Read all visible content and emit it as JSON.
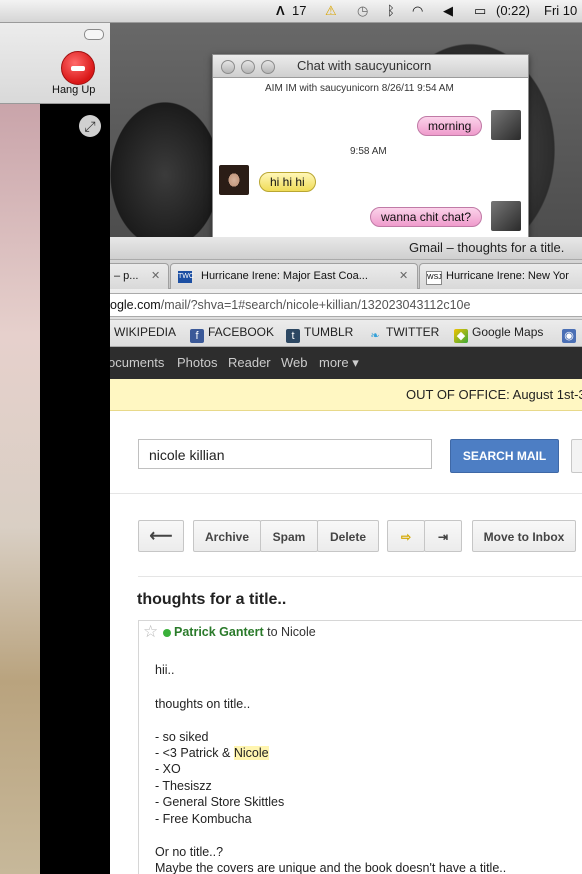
{
  "menubar": {
    "adobe_count": "17",
    "battery_time": "(0:22)",
    "clock": "Fri 10"
  },
  "video_chat": {
    "hang_up_label": "Hang Up"
  },
  "chat": {
    "window_title": "Chat with saucyunicorn",
    "session_info": "AIM IM with saucyunicorn  8/26/11 9:54 AM",
    "time_stamp": "9:58 AM",
    "messages": [
      "morning",
      "hi hi hi",
      "wanna chit chat?"
    ]
  },
  "browser": {
    "window_title": "Gmail – thoughts for a title.",
    "tabs": [
      {
        "label": "– p...",
        "icon": "page-icon"
      },
      {
        "label": "Hurricane Irene: Major East Coa...",
        "icon": "twc-icon"
      },
      {
        "label": "Hurricane Irene: New Yor",
        "icon": "wsj-icon"
      }
    ],
    "url_domain": "ogle.com",
    "url_path": "/mail/?shva=1#search/nicole+killian/132023043112c10e",
    "bookmarks": [
      "WIKIPEDIA",
      "FACEBOOK",
      "TUMBLR",
      "TWITTER",
      "Google Maps"
    ]
  },
  "gmail": {
    "nav": [
      "ocuments",
      "Photos",
      "Reader",
      "Web",
      "more ▾"
    ],
    "promo": "OUT OF OFFICE: August 1st-3",
    "search_value": "nicole killian",
    "search_button": "SEARCH MAIL",
    "toolbar": {
      "archive": "Archive",
      "spam": "Spam",
      "delete": "Delete",
      "move_to_inbox": "Move to Inbox"
    },
    "subject": "thoughts for a title..",
    "message": {
      "sender": "Patrick Gantert",
      "to_text": "to Nicole",
      "greeting": "hii..",
      "intro": "thoughts on title..",
      "list_1": "- so siked",
      "list_2_prefix": "- <3 Patrick & ",
      "list_2_name": "Nicole",
      "list_3": "- XO",
      "list_4": "- Thesiszz",
      "list_5": "- General Store Skittles",
      "list_6": "- Free Kombucha",
      "closing_1": "Or no title..?",
      "closing_2": "Maybe the covers are unique and the book doesn't have a title.."
    }
  }
}
